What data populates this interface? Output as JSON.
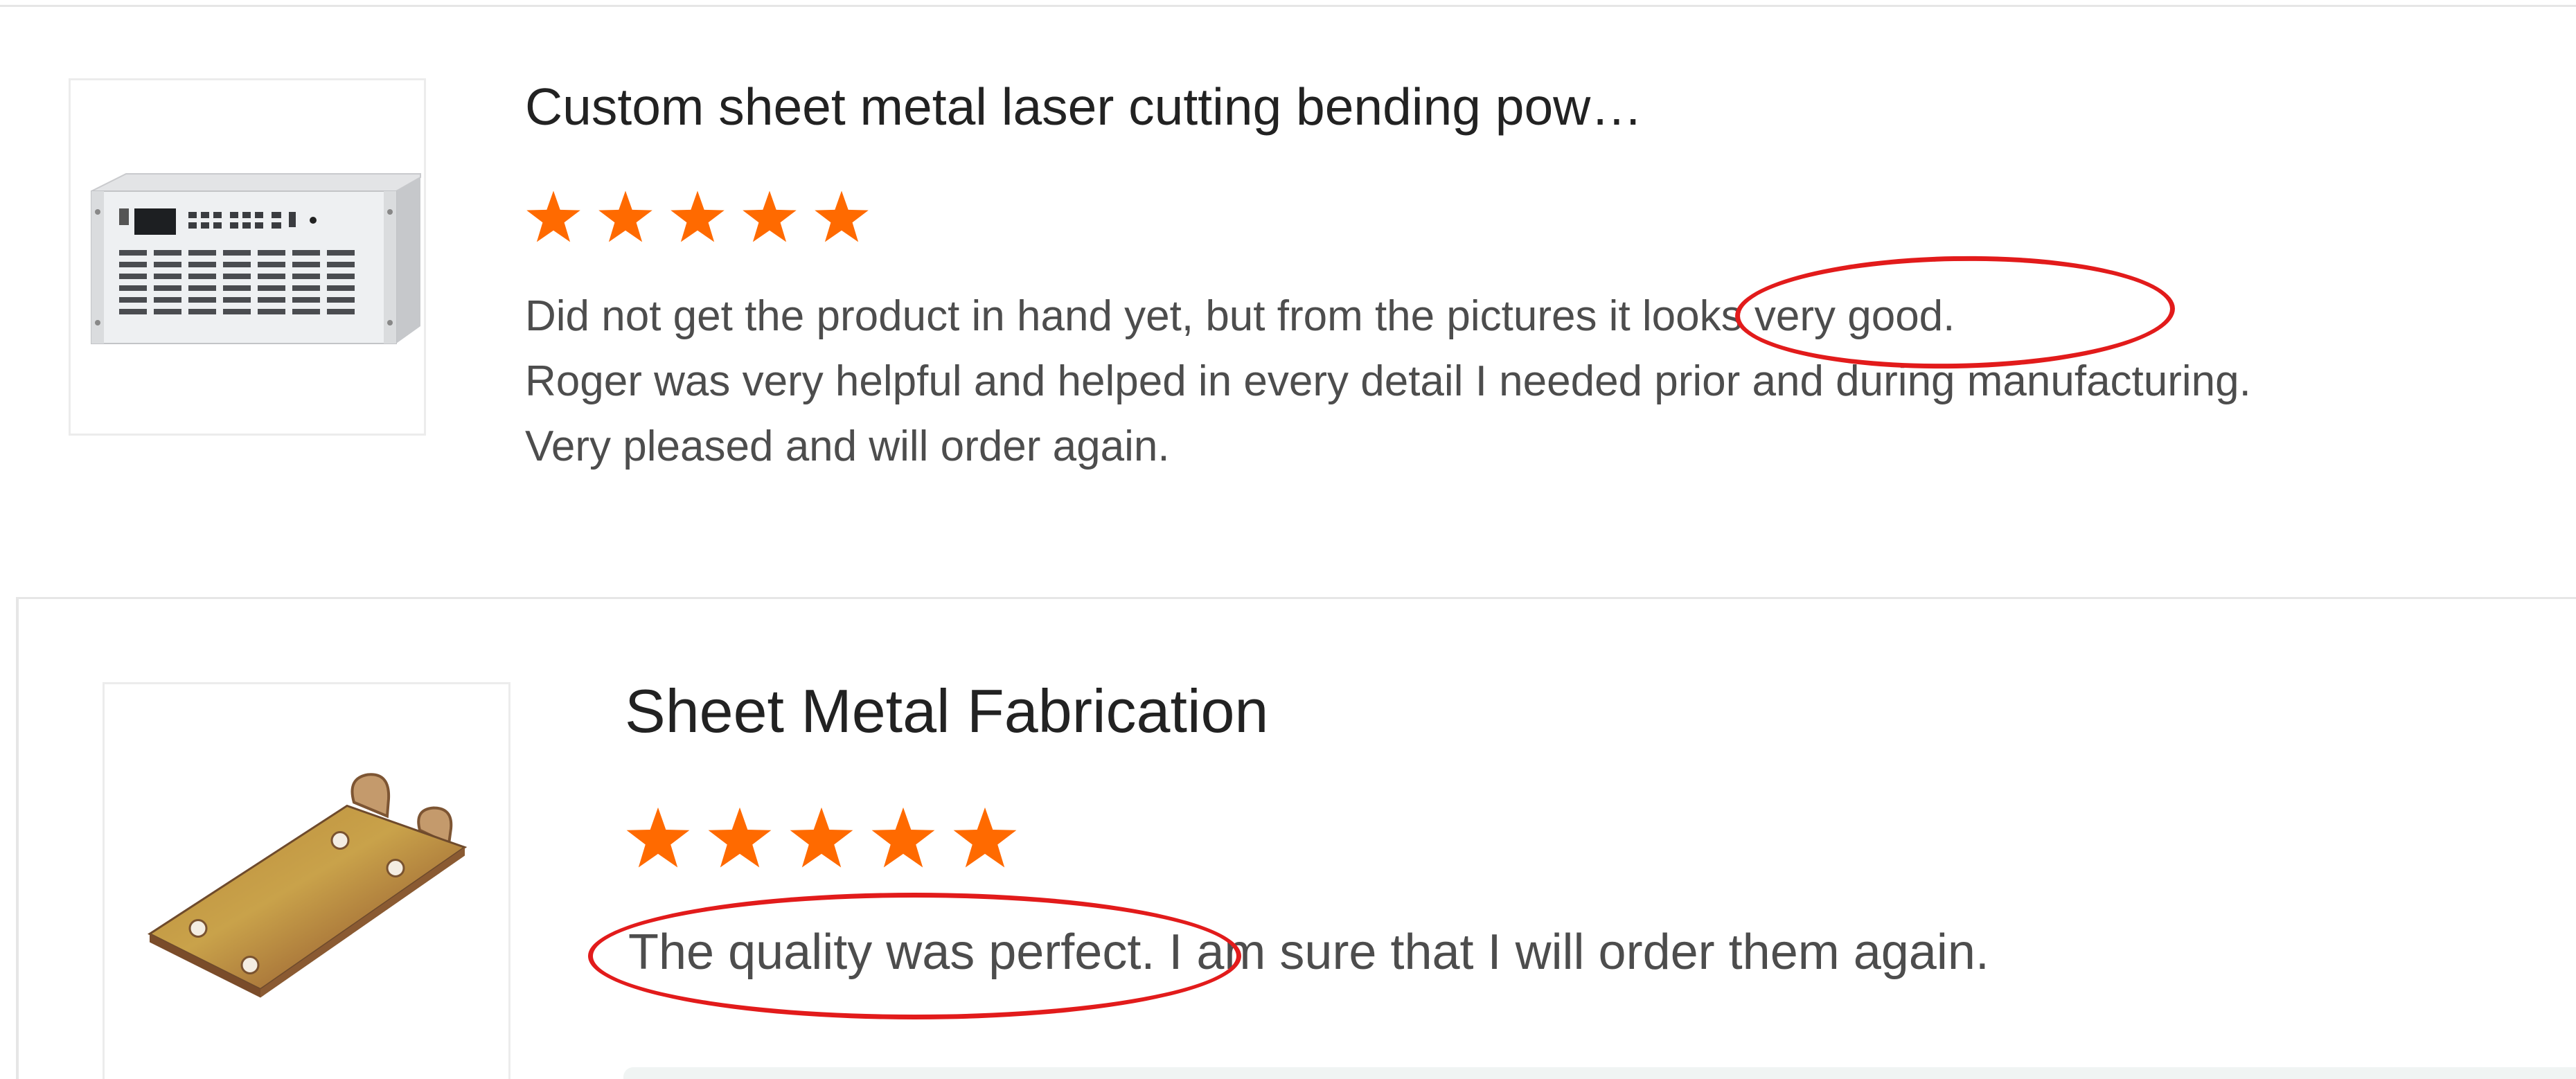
{
  "colors": {
    "star": "#ff6a00",
    "highlight": "#e21b1b",
    "title": "#222222",
    "body_text": "#4d4d4d",
    "divider": "#e6e6e6"
  },
  "reviews": [
    {
      "product_title": "Custom sheet metal laser cutting bending pow…",
      "product_image": "power-supply-rack-unit-image",
      "rating": 5,
      "rating_max": 5,
      "text_lines": [
        "Did not get the product in hand yet, but from the pictures it looks very good.",
        "Roger was very helpful and helped in every detail I needed prior and during manufacturing.",
        "Very pleased and will order again."
      ]
    },
    {
      "product_title": "Sheet Metal Fabrication",
      "product_image": "brass-hinge-plate-image",
      "rating": 5,
      "rating_max": 5,
      "text_lines": [
        "The quality was perfect. I am sure that I will order them again."
      ]
    }
  ]
}
